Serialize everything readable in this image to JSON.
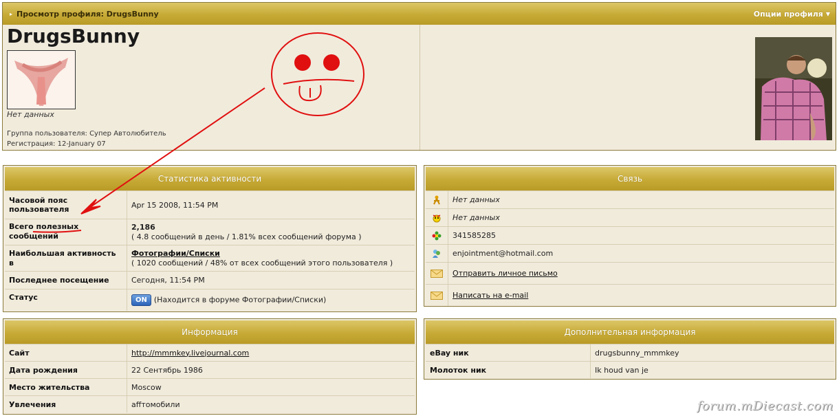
{
  "profile": {
    "bar_title": "Просмотр профиля: DrugsBunny",
    "options_label": "Опции профиля",
    "username": "DrugsBunny",
    "no_data": "Нет данных",
    "group": "Группа пользователя: Супер Автолюбитель",
    "registration": "Регистрация: 12-January 07"
  },
  "stats": {
    "title": "Статистика активности",
    "rows": [
      {
        "key": "Часовой пояс пользователя",
        "value": "Apr 15 2008, 11:54 PM"
      },
      {
        "key_a": "Всего ",
        "key_b": "полезных",
        "key_c": "сообщений",
        "value": "2,186",
        "sub": "( 4.8 сообщений в день / 1.81% всех сообщений форума )"
      },
      {
        "key": "Наибольшая активность в",
        "value": "Фотографии/Списки",
        "sub": "( 1020 сообщений / 48% от всех сообщений этого пользователя )"
      },
      {
        "key": "Последнее посещение",
        "value": "Сегодня, 11:54 PM"
      },
      {
        "key": "Статус",
        "badge": "ON",
        "value": "(Находится в форуме Фотографии/Списки)"
      }
    ]
  },
  "contact": {
    "title": "Связь",
    "rows": [
      {
        "icon": "aim-icon",
        "value": "Нет данных"
      },
      {
        "icon": "yahoo-icon",
        "value": "Нет данных"
      },
      {
        "icon": "icq-flower-icon",
        "value": "341585285"
      },
      {
        "icon": "msn-icon",
        "value": "enjointment@hotmail.com"
      },
      {
        "icon": "envelope-icon",
        "value": "Отправить личное письмо"
      },
      {
        "icon": "envelope-icon",
        "value": "Написать на e-mail"
      }
    ]
  },
  "info": {
    "title": "Информация",
    "rows": [
      {
        "key": "Сайт",
        "value": "http://mmmkey.livejournal.com"
      },
      {
        "key": "Дата рождения",
        "value": "22 Сентябрь 1986"
      },
      {
        "key": "Место жительства",
        "value": "Moscow"
      },
      {
        "key": "Увлечения",
        "value": "affтомобили"
      }
    ]
  },
  "extra": {
    "title": "Дополнительная информация",
    "rows": [
      {
        "key": "eBay ник",
        "value": "drugsbunny_mmmkey"
      },
      {
        "key": "Молоток ник",
        "value": "Ik houd van je"
      }
    ]
  },
  "watermark": "forum.mDiecast.com",
  "colors": {
    "header_gold": "#c7aa36",
    "panel_bg": "#f1ebdc",
    "annotation_red": "#e01010"
  }
}
